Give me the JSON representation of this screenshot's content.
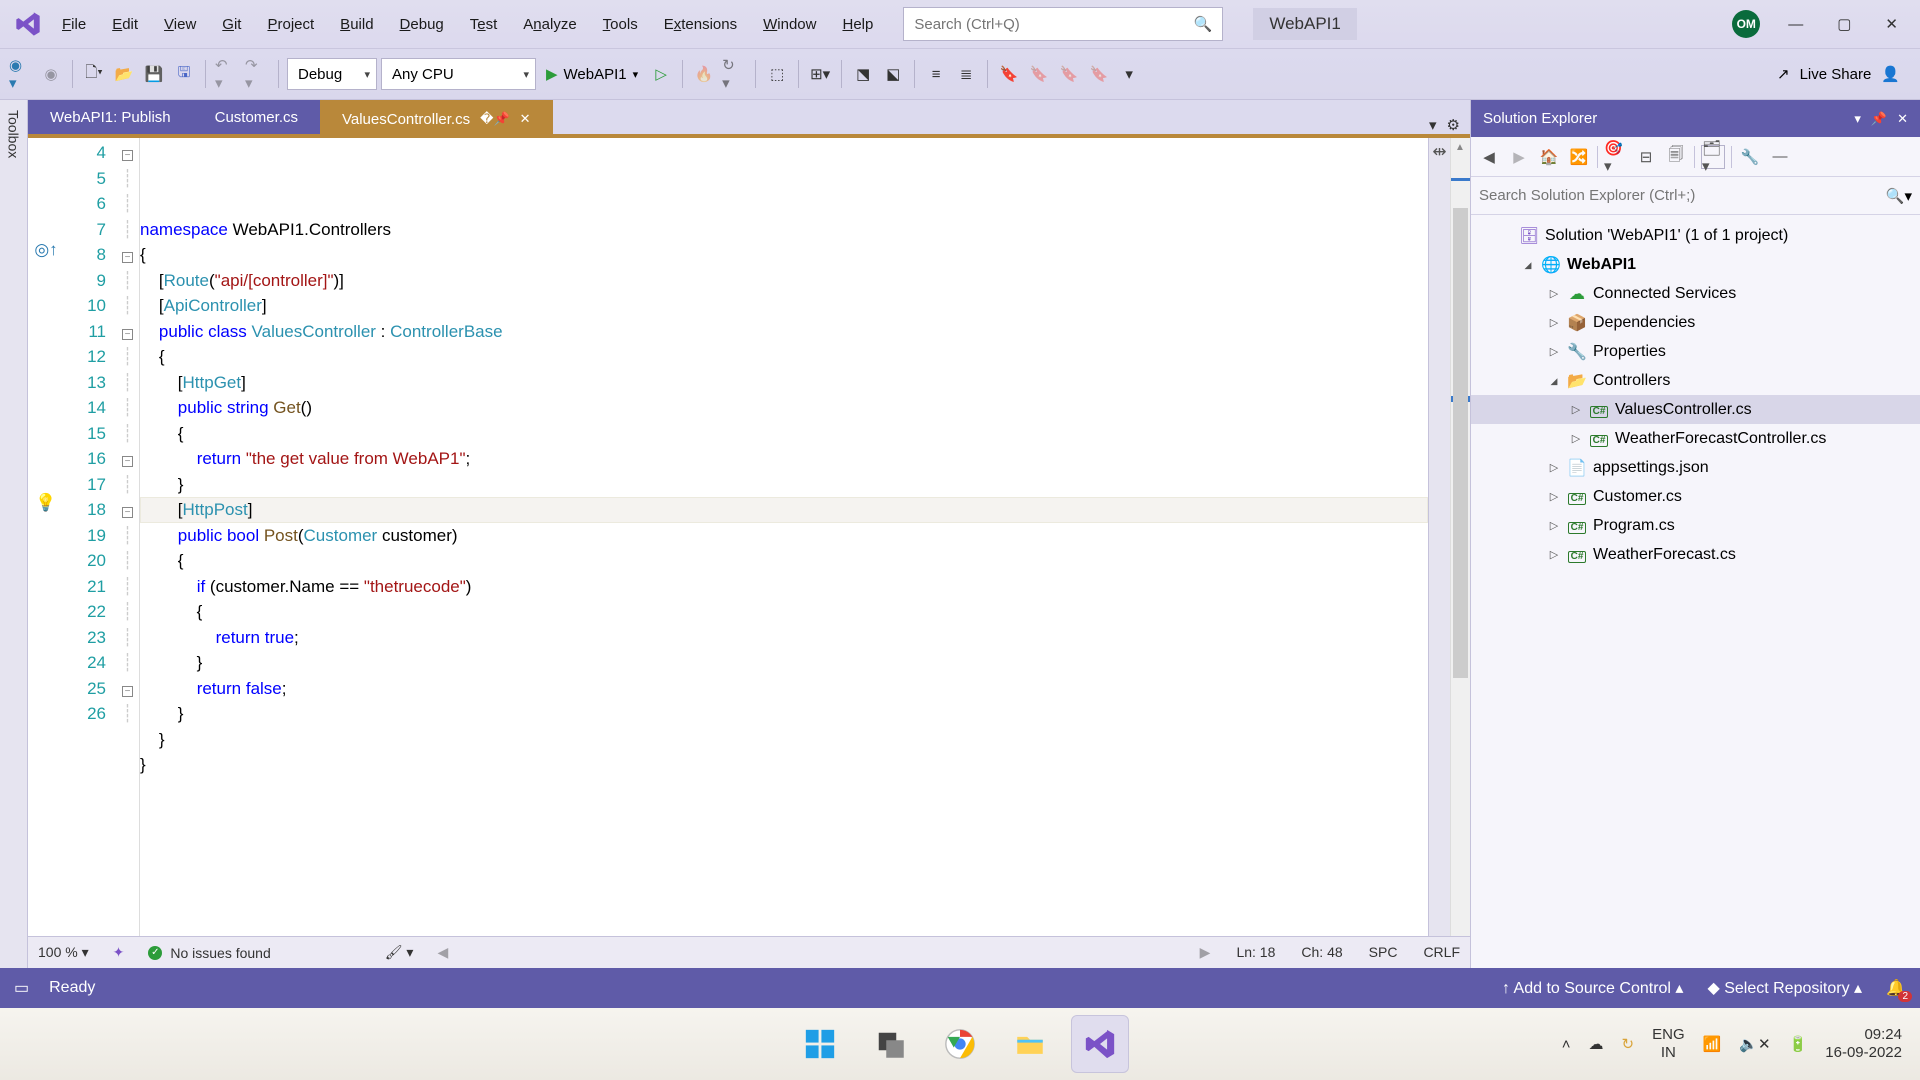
{
  "colors": {
    "purple": "#5f5ba8",
    "amber": "#b9883a",
    "kw": "#0000ff",
    "cls": "#2b91af",
    "str": "#a31515"
  },
  "menu": {
    "file": "File",
    "edit": "Edit",
    "view": "View",
    "git": "Git",
    "project": "Project",
    "build": "Build",
    "debug": "Debug",
    "test": "Test",
    "analyze": "Analyze",
    "tools": "Tools",
    "extensions": "Extensions",
    "window": "Window",
    "help": "Help"
  },
  "search": {
    "placeholder": "Search (Ctrl+Q)"
  },
  "project": {
    "name": "WebAPI1"
  },
  "avatar": {
    "initials": "OM"
  },
  "toolbar": {
    "config": "Debug",
    "platform": "Any CPU",
    "runTarget": "WebAPI1",
    "liveShare": "Live Share"
  },
  "toolbox": {
    "label": "Toolbox"
  },
  "tabs": {
    "t1": "WebAPI1: Publish",
    "t2": "Customer.cs",
    "t3": "ValuesController.cs"
  },
  "code": {
    "start": 4,
    "lines": [
      {
        "n": 4,
        "html": "<span class='kw'>namespace</span> WebAPI1.Controllers"
      },
      {
        "n": 5,
        "html": "{"
      },
      {
        "n": 6,
        "html": "    [<span class='cls'>Route</span>(<span class='str'>\"api/[controller]\"</span>)]"
      },
      {
        "n": 7,
        "html": "    [<span class='cls'>ApiController</span>]"
      },
      {
        "n": 8,
        "html": "    <span class='kw'>public</span> <span class='kw'>class</span> <span class='cls'>ValuesController</span> : <span class='cls'>ControllerBase</span>"
      },
      {
        "n": 9,
        "html": "    {"
      },
      {
        "n": 10,
        "html": "        [<span class='cls'>HttpGet</span>]"
      },
      {
        "n": 11,
        "html": "        <span class='kw'>public</span> <span class='kw'>string</span> <span class='mth'>Get</span>()"
      },
      {
        "n": 12,
        "html": "        {"
      },
      {
        "n": 13,
        "html": "            <span class='kw'>return</span> <span class='str'>\"the get value from WebAP1\"</span>;"
      },
      {
        "n": 14,
        "html": "        }"
      },
      {
        "n": 15,
        "html": "        [<span class='cls'>HttpPost</span>]"
      },
      {
        "n": 16,
        "html": "        <span class='kw'>public</span> <span class='kw'>bool</span> <span class='mth'>Post</span>(<span class='cls'>Customer</span> customer)"
      },
      {
        "n": 17,
        "html": "        {"
      },
      {
        "n": 18,
        "html": "            <span class='kw'>if</span> (customer.Name == <span class='str'>\"thetruecode\"</span>)"
      },
      {
        "n": 19,
        "html": "            {"
      },
      {
        "n": 20,
        "html": "                <span class='kw'>return</span> <span class='kw'>true</span>;"
      },
      {
        "n": 21,
        "html": "            }"
      },
      {
        "n": 22,
        "html": "            <span class='kw'>return</span> <span class='kw'>false</span>;"
      },
      {
        "n": 23,
        "html": "        }"
      },
      {
        "n": 24,
        "html": "    }"
      },
      {
        "n": 25,
        "html": "}"
      },
      {
        "n": 26,
        "html": ""
      }
    ]
  },
  "editorStatus": {
    "zoom": "100 %",
    "issues": "No issues found",
    "ln": "Ln: 18",
    "ch": "Ch: 48",
    "spc": "SPC",
    "eol": "CRLF"
  },
  "solExp": {
    "title": "Solution Explorer",
    "searchPlaceholder": "Search Solution Explorer (Ctrl+;)",
    "solution": "Solution 'WebAPI1' (1 of 1 project)",
    "proj": "WebAPI1",
    "connected": "Connected Services",
    "deps": "Dependencies",
    "props": "Properties",
    "controllers": "Controllers",
    "values": "ValuesController.cs",
    "weather": "WeatherForecastController.cs",
    "appsettings": "appsettings.json",
    "customer": "Customer.cs",
    "program": "Program.cs",
    "wforecast": "WeatherForecast.cs"
  },
  "statusbar": {
    "ready": "Ready",
    "addSrc": "Add to Source Control",
    "selectRepo": "Select Repository",
    "notif": "2"
  },
  "tray": {
    "lang1": "ENG",
    "lang2": "IN",
    "time": "09:24",
    "date": "16-09-2022"
  }
}
